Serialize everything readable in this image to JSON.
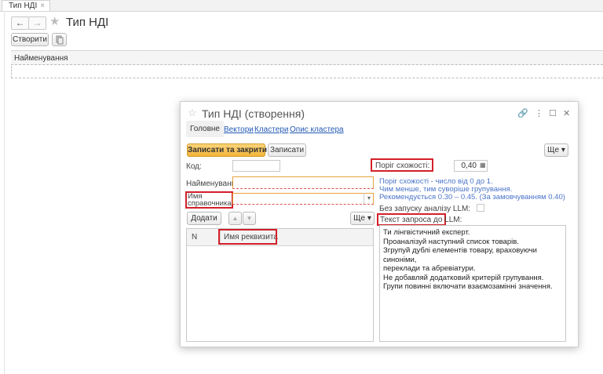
{
  "tab": {
    "label": "Тип НДІ",
    "close": "×"
  },
  "page": {
    "back": "←",
    "forward": "→",
    "title": "Тип НДІ",
    "create_button": "Створити",
    "list_header": "Найменування"
  },
  "dialog": {
    "title": "Тип НДІ (створення)",
    "controls": {
      "link": "🔗",
      "more": "⋮",
      "maximize": "☐",
      "close": "✕"
    },
    "tabs": [
      "Головне",
      "Вектори",
      "Кластери",
      "Опис кластера"
    ],
    "save_close": "Записати та закрити",
    "save": "Записати",
    "more_button": "Ще ▾",
    "fields": {
      "code_label": "Код:",
      "code_value": "",
      "name_label": "Найменування:",
      "name_value": "",
      "ref_label_1": "Имя",
      "ref_label_2": "справочника:",
      "ref_value": ""
    },
    "table": {
      "add_button": "Додати",
      "up": "▲",
      "down": "▼",
      "more_button": "Ще ▾",
      "columns": [
        "N",
        "Имя реквизита"
      ]
    },
    "threshold": {
      "label": "Поріг схожості:",
      "value": "0,40",
      "hint1": "Поріг схожості - число від 0 до 1.",
      "hint2": "Чим менше, тим суворіше групування.",
      "hint3": "Рекомендується 0.30 – 0.45. (За замовчуванням 0.40)"
    },
    "no_llm_label": "Без запуску аналізу LLM:",
    "prompt_label": "Текст запроса до LLM:",
    "prompt_lines": [
      "Ти лінгвістичний експерт.",
      "Проаналізуй наступний список товарів.",
      "Згрупуй дублі елементів товару, враховуючи синоніми,",
      "переклади та абревіатури.",
      "Не добавляй додатковий критерій групування.",
      "Групи повинні включати взаємозамінні значення."
    ]
  },
  "colors": {
    "accent": "#f2b43a",
    "link": "#2359b5",
    "hint": "#4a74c9",
    "highlight": "#d3202a"
  }
}
